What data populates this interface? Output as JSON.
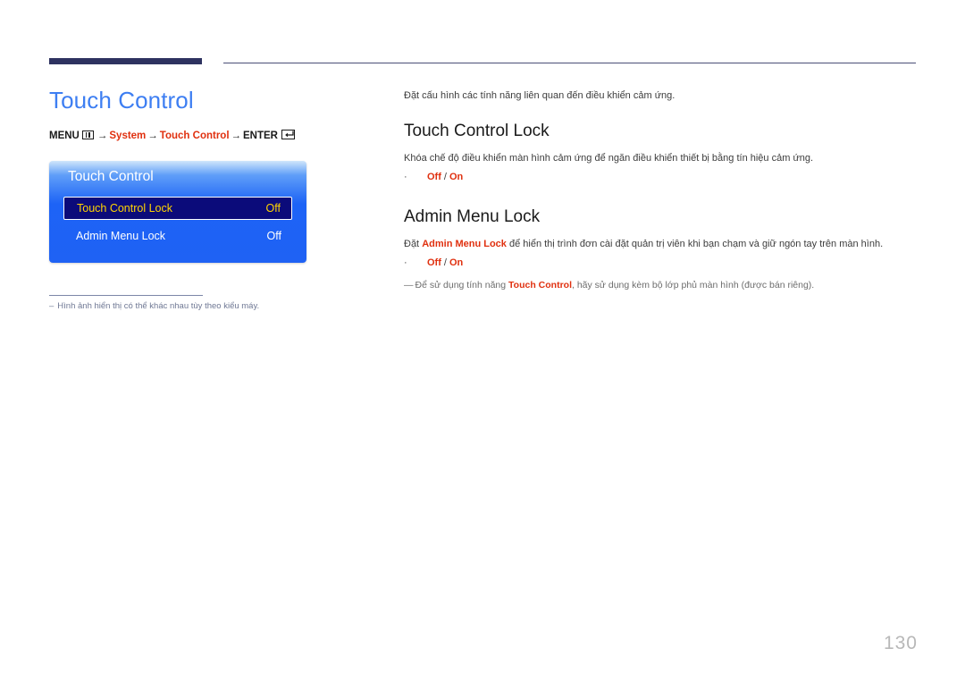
{
  "page": {
    "number": "130"
  },
  "left": {
    "title": "Touch Control",
    "menu_path": {
      "menu_label": "MENU",
      "menu_icon": "menu-grid-icon",
      "arrow": "→",
      "system_label": "System",
      "touch_control_label": "Touch Control",
      "enter_label": "ENTER",
      "enter_icon": "enter-key-icon"
    },
    "osd": {
      "title": "Touch Control",
      "rows": [
        {
          "label": "Touch Control Lock",
          "value": "Off",
          "selected": true
        },
        {
          "label": "Admin Menu Lock",
          "value": "Off",
          "selected": false
        }
      ]
    },
    "footnote": {
      "dash": "–",
      "text": "Hình ảnh hiển thị có thể khác nhau tùy theo kiểu máy."
    }
  },
  "right": {
    "intro": "Đặt cấu hình các tính năng liên quan đến điều khiển cảm ứng.",
    "sections": [
      {
        "heading": "Touch Control Lock",
        "body": "Khóa chế độ điều khiển màn hình cảm ứng để ngăn điều khiển thiết bị bằng tín hiệu cảm ứng.",
        "bullet": {
          "dot": "·",
          "option1": "Off",
          "separator": "/",
          "option2": "On"
        }
      },
      {
        "heading": "Admin Menu Lock",
        "body_prefix": "Đặt ",
        "body_accent": "Admin Menu Lock",
        "body_suffix": " để hiển thị trình đơn cài đặt quản trị viên khi bạn chạm và giữ ngón tay trên màn hình.",
        "bullet": {
          "dot": "·",
          "option1": "Off",
          "separator": "/",
          "option2": "On"
        }
      }
    ],
    "note": {
      "emdash": "—",
      "prefix": "Để sử dụng tính năng ",
      "accent": "Touch Control",
      "suffix": ", hãy sử dụng kèm bộ lớp phủ màn hình (được bán riêng)."
    }
  },
  "colors": {
    "title_blue": "#3d7ef2",
    "accent_red": "#e0300f",
    "rule_navy": "#2e3260",
    "osd_blue": "#1f62f4",
    "osd_selected": "#0b0b7a",
    "osd_highlight_text": "#ffd400"
  }
}
